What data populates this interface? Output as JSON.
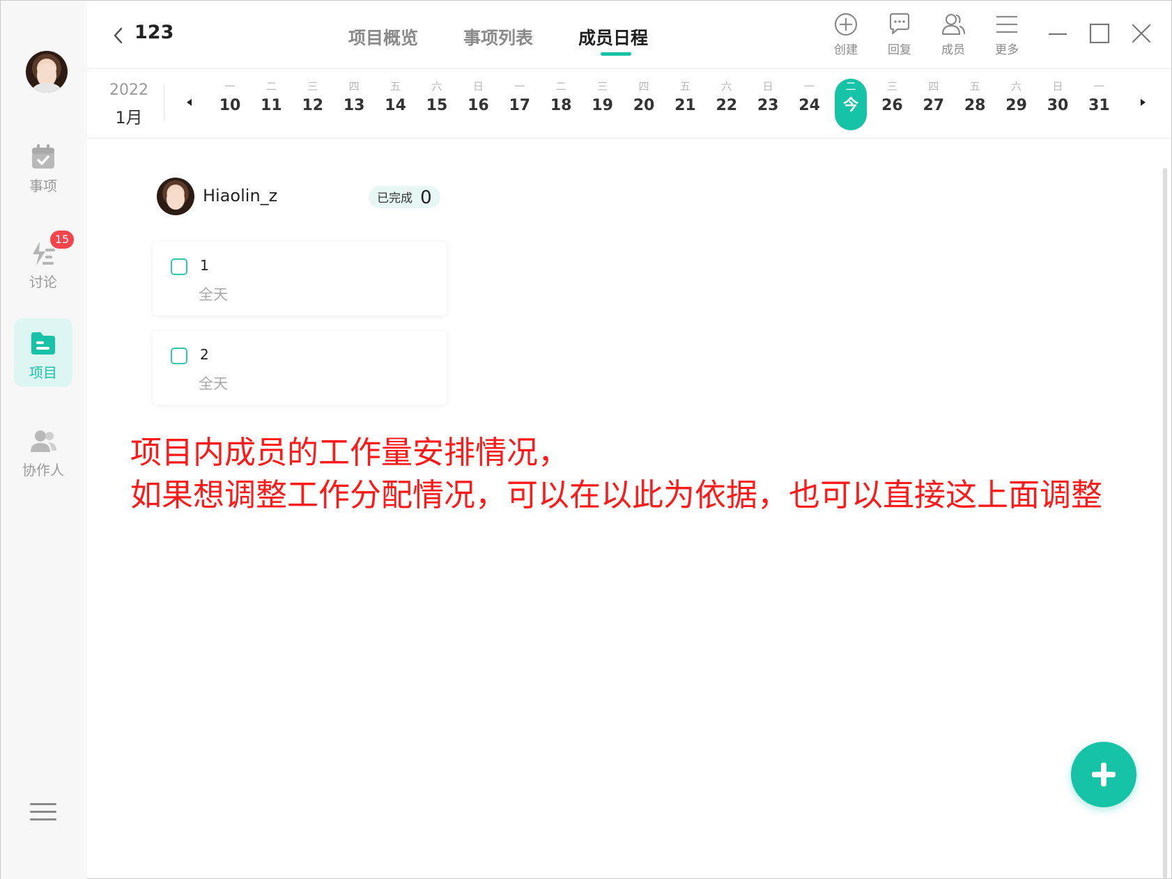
{
  "sidebar": {
    "items": [
      {
        "label": "事项"
      },
      {
        "label": "讨论",
        "badge": "15"
      },
      {
        "label": "项目"
      },
      {
        "label": "协作人"
      }
    ]
  },
  "header": {
    "title": "123",
    "tabs": [
      {
        "label": "项目概览"
      },
      {
        "label": "事项列表"
      },
      {
        "label": "成员日程"
      }
    ],
    "tools": [
      {
        "label": "创建",
        "icon": "plus-circle-icon"
      },
      {
        "label": "回复",
        "icon": "chat-bubble-icon"
      },
      {
        "label": "成员",
        "icon": "members-icon"
      },
      {
        "label": "更多",
        "icon": "menu-icon"
      }
    ]
  },
  "calendar": {
    "year": "2022",
    "month": "1月",
    "days": [
      {
        "wd": "一",
        "dn": "10"
      },
      {
        "wd": "二",
        "dn": "11"
      },
      {
        "wd": "三",
        "dn": "12"
      },
      {
        "wd": "四",
        "dn": "13"
      },
      {
        "wd": "五",
        "dn": "14"
      },
      {
        "wd": "六",
        "dn": "15"
      },
      {
        "wd": "日",
        "dn": "16"
      },
      {
        "wd": "一",
        "dn": "17"
      },
      {
        "wd": "二",
        "dn": "18"
      },
      {
        "wd": "三",
        "dn": "19"
      },
      {
        "wd": "四",
        "dn": "20"
      },
      {
        "wd": "五",
        "dn": "21"
      },
      {
        "wd": "六",
        "dn": "22"
      },
      {
        "wd": "日",
        "dn": "23"
      },
      {
        "wd": "一",
        "dn": "24"
      },
      {
        "wd": "二",
        "dn": "今"
      },
      {
        "wd": "三",
        "dn": "26"
      },
      {
        "wd": "四",
        "dn": "27"
      },
      {
        "wd": "五",
        "dn": "28"
      },
      {
        "wd": "六",
        "dn": "29"
      },
      {
        "wd": "日",
        "dn": "30"
      },
      {
        "wd": "一",
        "dn": "31"
      }
    ]
  },
  "member": {
    "name": "Hiaolin_z",
    "done_label": "已完成",
    "done_count": "0",
    "tasks": [
      {
        "title": "1",
        "time": "全天"
      },
      {
        "title": "2",
        "time": "全天"
      }
    ]
  },
  "annotation": {
    "line1": "项目内成员的工作量安排情况，",
    "line2": "如果想调整工作分配情况，可以在以此为依据，也可以直接这上面调整"
  },
  "colors": {
    "accent": "#17c3a6",
    "badge": "#f5444c",
    "annotation": "#ff1a1a"
  }
}
